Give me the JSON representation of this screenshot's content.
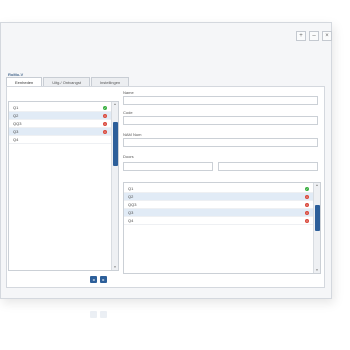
{
  "window": {
    "controls": [
      "+",
      "–",
      "×"
    ],
    "title": "RoMo-V"
  },
  "tabs": [
    {
      "label": "Eenheden",
      "active": true
    },
    {
      "label": "Uitg./ Ontvangst",
      "active": false
    },
    {
      "label": "Instellingen",
      "active": false
    }
  ],
  "left_list": {
    "items": [
      {
        "label": "Q1",
        "status": "ok",
        "selected": false
      },
      {
        "label": "Q2",
        "status": "err",
        "selected": true
      },
      {
        "label": "QQ3",
        "status": "err",
        "selected": false
      },
      {
        "label": "Q3",
        "status": "err",
        "selected": true
      },
      {
        "label": "Q4",
        "status": "",
        "selected": false
      }
    ]
  },
  "form": {
    "name_label": "Name",
    "name_value": "",
    "code_label": "Code",
    "code_value": "",
    "extra_label": "NAM Num",
    "extra_value": "",
    "doors_label": "Doors",
    "doors_value_1": "",
    "doors_value_2": ""
  },
  "right_list": {
    "items": [
      {
        "label": "Q1",
        "status": "ok",
        "selected": false
      },
      {
        "label": "Q2",
        "status": "err",
        "selected": true
      },
      {
        "label": "QQ3",
        "status": "err",
        "selected": false
      },
      {
        "label": "Q3",
        "status": "err",
        "selected": true
      },
      {
        "label": "Q4",
        "status": "err",
        "selected": false
      }
    ]
  },
  "nav": {
    "prev": "◂",
    "next": "▸"
  },
  "scroll": {
    "up": "▲",
    "down": "▼"
  },
  "status_glyphs": {
    "ok": "✓",
    "err": "×"
  },
  "colors": {
    "accent": "#2d5f9a",
    "ok": "#3cb043",
    "err": "#d9483b"
  }
}
